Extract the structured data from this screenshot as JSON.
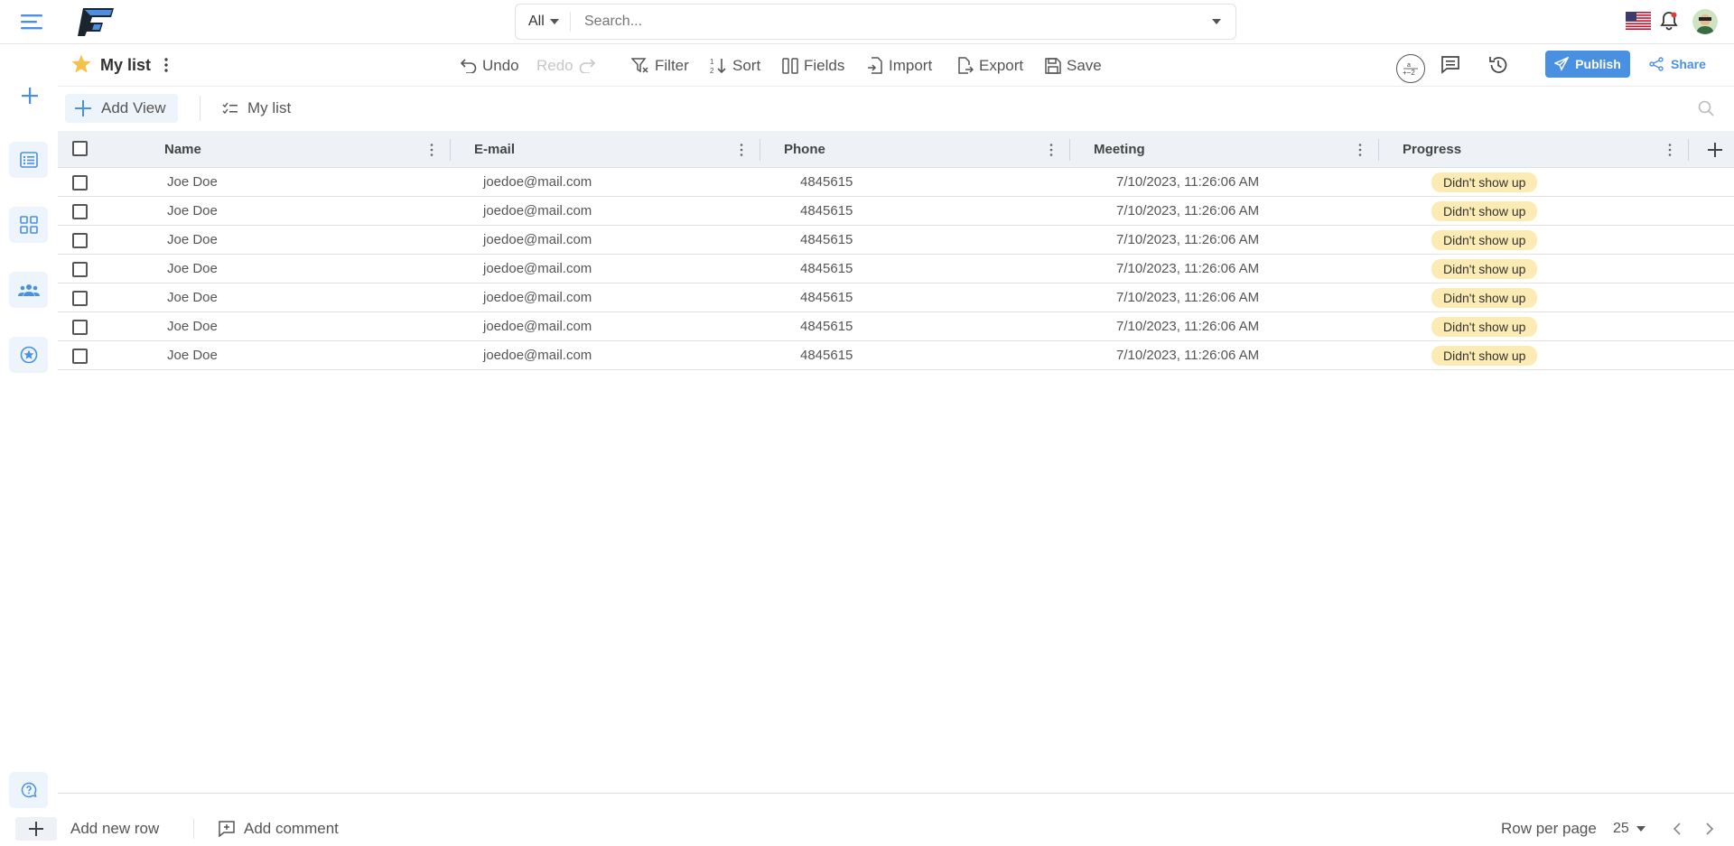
{
  "topbar": {
    "search_scope": "All",
    "search_placeholder": "Search..."
  },
  "toolbar": {
    "list_title": "My list",
    "undo_label": "Undo",
    "redo_label": "Redo",
    "filter_label": "Filter",
    "sort_label": "Sort",
    "fields_label": "Fields",
    "import_label": "Import",
    "export_label": "Export",
    "save_label": "Save",
    "publish_label": "Publish",
    "share_label": "Share"
  },
  "views": {
    "add_view_label": "Add View",
    "active_view_label": "My list"
  },
  "table": {
    "columns": [
      "Name",
      "E-mail",
      "Phone",
      "Meeting",
      "Progress"
    ],
    "rows": [
      {
        "name": "Joe Doe",
        "email": "joedoe@mail.com",
        "phone": "4845615",
        "meeting": "7/10/2023, 11:26:06 AM",
        "progress": "Didn't show up"
      },
      {
        "name": "Joe Doe",
        "email": "joedoe@mail.com",
        "phone": "4845615",
        "meeting": "7/10/2023, 11:26:06 AM",
        "progress": "Didn't show up"
      },
      {
        "name": "Joe Doe",
        "email": "joedoe@mail.com",
        "phone": "4845615",
        "meeting": "7/10/2023, 11:26:06 AM",
        "progress": "Didn't show up"
      },
      {
        "name": "Joe Doe",
        "email": "joedoe@mail.com",
        "phone": "4845615",
        "meeting": "7/10/2023, 11:26:06 AM",
        "progress": "Didn't show up"
      },
      {
        "name": "Joe Doe",
        "email": "joedoe@mail.com",
        "phone": "4845615",
        "meeting": "7/10/2023, 11:26:06 AM",
        "progress": "Didn't show up"
      },
      {
        "name": "Joe Doe",
        "email": "joedoe@mail.com",
        "phone": "4845615",
        "meeting": "7/10/2023, 11:26:06 AM",
        "progress": "Didn't show up"
      },
      {
        "name": "Joe Doe",
        "email": "joedoe@mail.com",
        "phone": "4845615",
        "meeting": "7/10/2023, 11:26:06 AM",
        "progress": "Didn't show up"
      }
    ]
  },
  "footer": {
    "add_row_label": "Add new row",
    "add_comment_label": "Add comment",
    "rows_per_page_label": "Row per page",
    "rows_per_page_value": "25"
  },
  "colors": {
    "accent": "#4a90e2",
    "badge_bg": "#fcecb3",
    "header_bg": "#eef1f5"
  },
  "icons": [
    "menu-icon",
    "logo",
    "chevron-down-icon",
    "us-flag-icon",
    "bell-icon",
    "avatar",
    "plus-icon",
    "list-icon",
    "grid-icon",
    "team-icon",
    "star-circle-icon",
    "help-icon",
    "star-icon",
    "more-vertical-icon",
    "undo-icon",
    "redo-icon",
    "filter-icon",
    "sort-icon",
    "fields-icon",
    "import-icon",
    "export-icon",
    "save-icon",
    "formula-icon",
    "comment-icon",
    "history-icon",
    "send-icon",
    "share-icon",
    "checklist-icon",
    "search-icon",
    "chevron-left-icon",
    "chevron-right-icon",
    "add-comment-icon"
  ]
}
